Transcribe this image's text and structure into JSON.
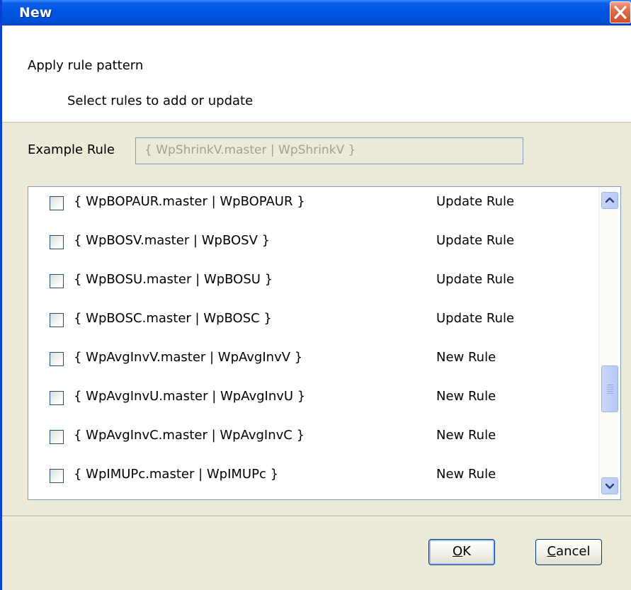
{
  "window": {
    "title": "New"
  },
  "header": {
    "title": "Apply rule pattern",
    "subtitle": "Select rules to add or update"
  },
  "example": {
    "label": "Example Rule",
    "value": "{ WpShrinkV.master | WpShrinkV }"
  },
  "rules": [
    {
      "label": "{ WpBOPAUR.master | WpBOPAUR }",
      "status": "Update Rule",
      "checked": false
    },
    {
      "label": "{ WpBOSV.master | WpBOSV }",
      "status": "Update Rule",
      "checked": false
    },
    {
      "label": "{ WpBOSU.master | WpBOSU }",
      "status": "Update Rule",
      "checked": false
    },
    {
      "label": "{ WpBOSC.master | WpBOSC }",
      "status": "Update Rule",
      "checked": false
    },
    {
      "label": "{ WpAvgInvV.master | WpAvgInvV }",
      "status": "New Rule",
      "checked": false
    },
    {
      "label": "{ WpAvgInvU.master | WpAvgInvU }",
      "status": "New Rule",
      "checked": false
    },
    {
      "label": "{ WpAvgInvC.master | WpAvgInvC }",
      "status": "New Rule",
      "checked": false
    },
    {
      "label": "{ WpIMUPc.master | WpIMUPc }",
      "status": "New Rule",
      "checked": false
    }
  ],
  "buttons": {
    "ok_mnemonic": "O",
    "ok_rest": "K",
    "cancel_mnemonic": "C",
    "cancel_rest": "ancel"
  },
  "icons": {
    "close": "close-icon",
    "scroll_up": "chevron-up-icon",
    "scroll_down": "chevron-down-icon",
    "thumb_grip": "grip-icon"
  },
  "colors": {
    "titlebar": "#0054e3",
    "dialog_bg": "#ece9d8",
    "close_button": "#d14d26"
  }
}
